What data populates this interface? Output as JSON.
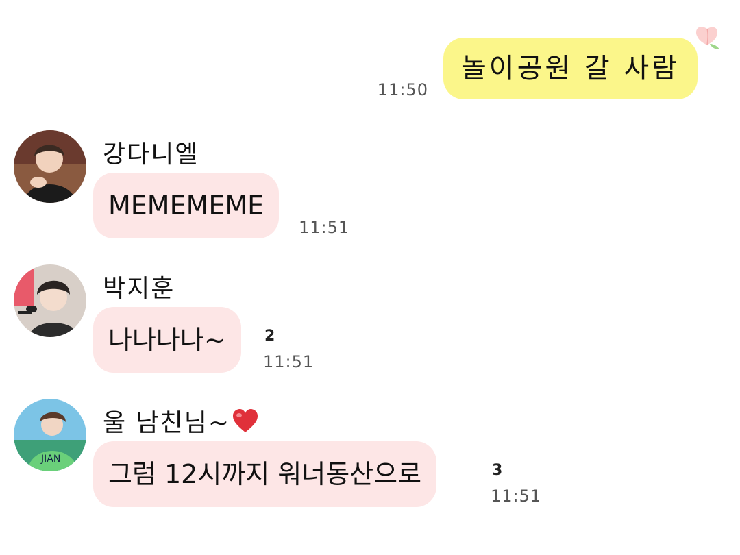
{
  "outgoing": {
    "text": "놀이공원 갈 사람",
    "time": "11:50",
    "sticker_icon": "peach-icon"
  },
  "messages": [
    {
      "sender": "강다니엘",
      "text": "MEMEMEME",
      "time": "11:51",
      "unread": "",
      "avatar_color": "#7a4a3a"
    },
    {
      "sender": "박지훈",
      "text": "나나나나~",
      "time": "11:51",
      "unread": "2",
      "avatar_color": "#5a4a48"
    },
    {
      "sender": "울 남친님~",
      "sender_icon": "heart-icon",
      "text": "그럼 12시까지 워너동산으로",
      "time": "11:51",
      "unread": "3",
      "avatar_color": "#3f8fb8"
    }
  ],
  "colors": {
    "outgoing_bubble": "#fbf68a",
    "incoming_bubble": "#fde6e6",
    "heart": "#e0303a"
  }
}
